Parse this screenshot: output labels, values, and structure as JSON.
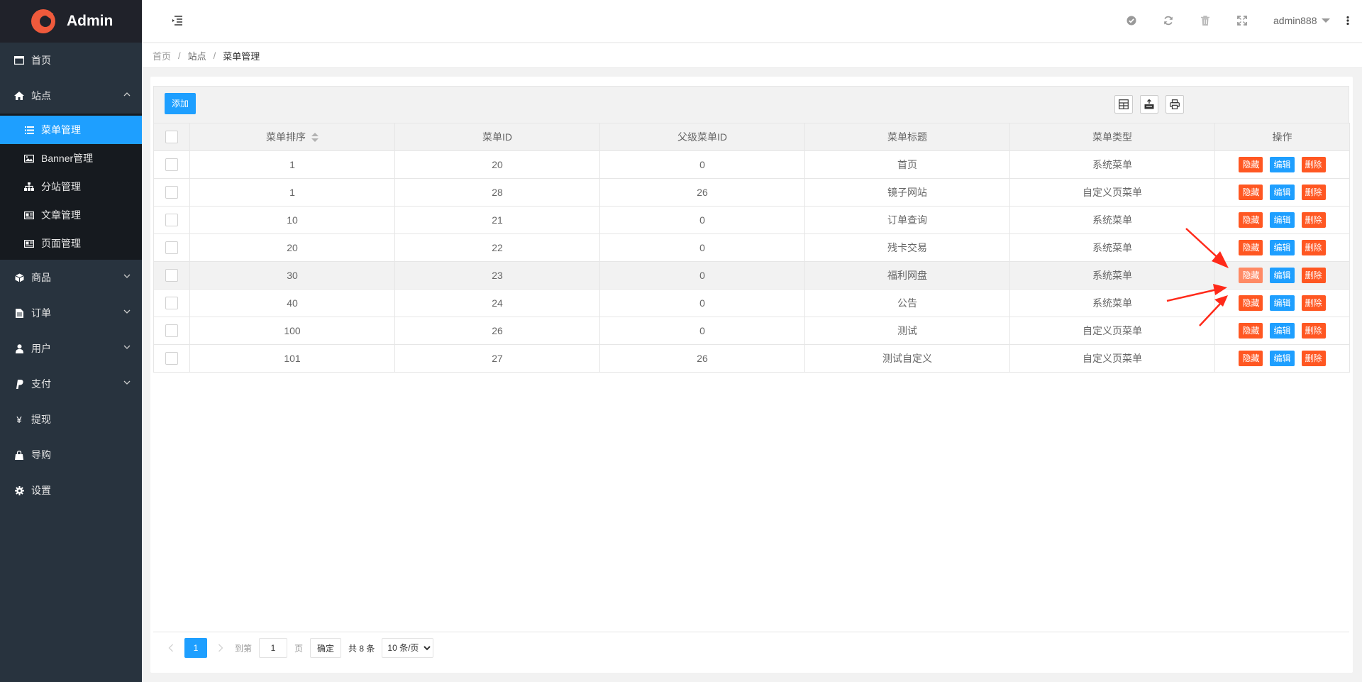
{
  "app": {
    "name": "Admin"
  },
  "sidebar": {
    "items": [
      {
        "label": "首页",
        "icon": "window-icon"
      },
      {
        "label": "站点",
        "icon": "home-icon",
        "expanded": true,
        "children": [
          {
            "label": "菜单管理",
            "icon": "list-icon",
            "active": true
          },
          {
            "label": "Banner管理",
            "icon": "picture-icon"
          },
          {
            "label": "分站管理",
            "icon": "sitemap-icon"
          },
          {
            "label": "文章管理",
            "icon": "newspaper-icon"
          },
          {
            "label": "页面管理",
            "icon": "newspaper-icon"
          }
        ]
      },
      {
        "label": "商品",
        "icon": "cube-icon"
      },
      {
        "label": "订单",
        "icon": "file-icon"
      },
      {
        "label": "用户",
        "icon": "user-icon"
      },
      {
        "label": "支付",
        "icon": "paypal-icon"
      },
      {
        "label": "提现",
        "icon": "yen-icon"
      },
      {
        "label": "导购",
        "icon": "bag-icon"
      },
      {
        "label": "设置",
        "icon": "gear-icon"
      }
    ]
  },
  "header": {
    "user": "admin888",
    "icons": [
      "check-circle-icon",
      "refresh-icon",
      "trash-icon",
      "fullscreen-icon",
      "more-vertical-icon"
    ]
  },
  "breadcrumb": [
    "首页",
    "站点",
    "菜单管理"
  ],
  "toolbar": {
    "add_label": "添加",
    "tools": [
      "columns-icon",
      "export-icon",
      "print-icon"
    ]
  },
  "table": {
    "columns": [
      "菜单排序",
      "菜单ID",
      "父级菜单ID",
      "菜单标题",
      "菜单类型",
      "操作"
    ],
    "actions": {
      "hide": "隐藏",
      "edit": "编辑",
      "delete": "删除"
    },
    "rows": [
      {
        "sort": "1",
        "id": "20",
        "parent": "0",
        "title": "首页",
        "type": "系统菜单"
      },
      {
        "sort": "1",
        "id": "28",
        "parent": "26",
        "title": "镜子网站",
        "type": "自定义页菜单"
      },
      {
        "sort": "10",
        "id": "21",
        "parent": "0",
        "title": "订单查询",
        "type": "系统菜单"
      },
      {
        "sort": "20",
        "id": "22",
        "parent": "0",
        "title": "残卡交易",
        "type": "系统菜单"
      },
      {
        "sort": "30",
        "id": "23",
        "parent": "0",
        "title": "福利网盘",
        "type": "系统菜单"
      },
      {
        "sort": "40",
        "id": "24",
        "parent": "0",
        "title": "公告",
        "type": "系统菜单"
      },
      {
        "sort": "100",
        "id": "26",
        "parent": "0",
        "title": "测试",
        "type": "自定义页菜单"
      },
      {
        "sort": "101",
        "id": "27",
        "parent": "26",
        "title": "测试自定义",
        "type": "自定义页菜单"
      }
    ]
  },
  "pager": {
    "current": "1",
    "goto_label": "到第",
    "goto_value": "1",
    "page_unit": "页",
    "confirm": "确定",
    "total": "共 8 条",
    "page_size": "10 条/页"
  },
  "colors": {
    "accent": "#1e9fff",
    "danger": "#ff5722",
    "sidebar": "#28333e",
    "annotation": "#ff2a1a"
  }
}
